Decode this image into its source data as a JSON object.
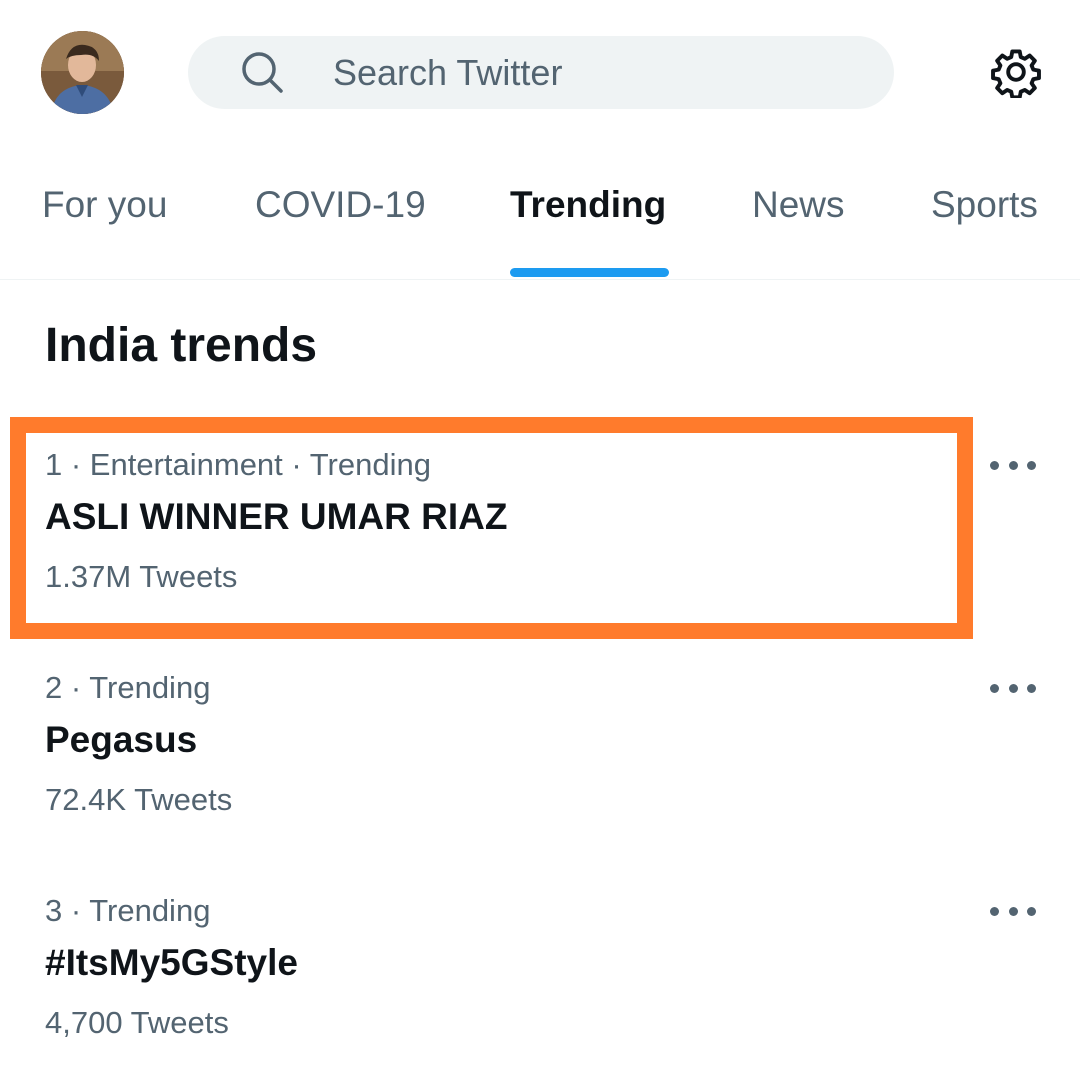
{
  "header": {
    "search_placeholder": "Search Twitter",
    "icons": {
      "search": "search-icon",
      "settings": "gear-icon",
      "avatar": "profile-avatar"
    }
  },
  "tabs": [
    {
      "label": "For you",
      "active": false
    },
    {
      "label": "COVID-19",
      "active": false
    },
    {
      "label": "Trending",
      "active": true
    },
    {
      "label": "News",
      "active": false
    },
    {
      "label": "Sports",
      "active": false
    }
  ],
  "section_title": "India trends",
  "trends": [
    {
      "meta": "1 · Entertainment · Trending",
      "name": "ASLI WINNER UMAR RIAZ",
      "count": "1.37M Tweets",
      "highlighted": true
    },
    {
      "meta": "2 · Trending",
      "name": "Pegasus",
      "count": "72.4K Tweets",
      "highlighted": false
    },
    {
      "meta": "3 · Trending",
      "name": "#ItsMy5GStyle",
      "count": "4,700 Tweets",
      "highlighted": false
    }
  ],
  "colors": {
    "accent": "#1d9bf0",
    "highlight_border": "#ff7b2c",
    "secondary_text": "#536471",
    "primary_text": "#0f1419",
    "search_bg": "#eff3f4"
  }
}
